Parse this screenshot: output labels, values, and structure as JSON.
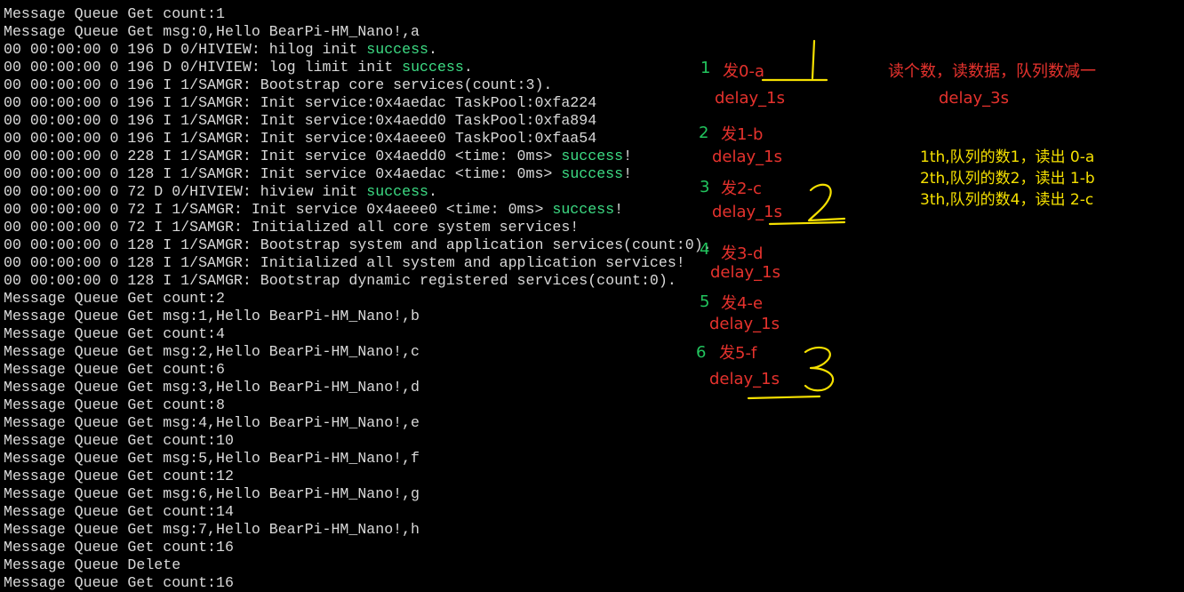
{
  "terminal": {
    "lines": [
      {
        "text": "Message Queue Get count:1"
      },
      {
        "text": "Message Queue Get msg:0,Hello BearPi-HM_Nano!,a"
      },
      {
        "text": "00 00:00:00 0 196 D 0/HIVIEW: hilog init ",
        "hl": "success",
        "tail": "."
      },
      {
        "text": "00 00:00:00 0 196 D 0/HIVIEW: log limit init ",
        "hl": "success",
        "tail": "."
      },
      {
        "text": "00 00:00:00 0 196 I 1/SAMGR: Bootstrap core services(count:3)."
      },
      {
        "text": "00 00:00:00 0 196 I 1/SAMGR: Init service:0x4aedac TaskPool:0xfa224"
      },
      {
        "text": "00 00:00:00 0 196 I 1/SAMGR: Init service:0x4aedd0 TaskPool:0xfa894"
      },
      {
        "text": "00 00:00:00 0 196 I 1/SAMGR: Init service:0x4aeee0 TaskPool:0xfaa54"
      },
      {
        "text": "00 00:00:00 0 228 I 1/SAMGR: Init service 0x4aedd0 <time: 0ms> ",
        "hl": "success",
        "tail": "!"
      },
      {
        "text": "00 00:00:00 0 128 I 1/SAMGR: Init service 0x4aedac <time: 0ms> ",
        "hl": "success",
        "tail": "!"
      },
      {
        "text": "00 00:00:00 0 72 D 0/HIVIEW: hiview init ",
        "hl": "success",
        "tail": "."
      },
      {
        "text": "00 00:00:00 0 72 I 1/SAMGR: Init service 0x4aeee0 <time: 0ms> ",
        "hl": "success",
        "tail": "!"
      },
      {
        "text": "00 00:00:00 0 72 I 1/SAMGR: Initialized all core system services!"
      },
      {
        "text": "00 00:00:00 0 128 I 1/SAMGR: Bootstrap system and application services(count:0)."
      },
      {
        "text": "00 00:00:00 0 128 I 1/SAMGR: Initialized all system and application services!"
      },
      {
        "text": "00 00:00:00 0 128 I 1/SAMGR: Bootstrap dynamic registered services(count:0)."
      },
      {
        "text": "Message Queue Get count:2"
      },
      {
        "text": "Message Queue Get msg:1,Hello BearPi-HM_Nano!,b"
      },
      {
        "text": "Message Queue Get count:4"
      },
      {
        "text": "Message Queue Get msg:2,Hello BearPi-HM_Nano!,c"
      },
      {
        "text": "Message Queue Get count:6"
      },
      {
        "text": "Message Queue Get msg:3,Hello BearPi-HM_Nano!,d"
      },
      {
        "text": "Message Queue Get count:8"
      },
      {
        "text": "Message Queue Get msg:4,Hello BearPi-HM_Nano!,e"
      },
      {
        "text": "Message Queue Get count:10"
      },
      {
        "text": "Message Queue Get msg:5,Hello BearPi-HM_Nano!,f"
      },
      {
        "text": "Message Queue Get count:12"
      },
      {
        "text": "Message Queue Get msg:6,Hello BearPi-HM_Nano!,g"
      },
      {
        "text": "Message Queue Get count:14"
      },
      {
        "text": "Message Queue Get msg:7,Hello BearPi-HM_Nano!,h"
      },
      {
        "text": "Message Queue Get count:16"
      },
      {
        "text": "Message Queue Delete"
      },
      {
        "text": "Message Queue Get count:16"
      }
    ]
  },
  "annotations": {
    "sends": [
      {
        "num": "1",
        "label": "发0-a",
        "delay": "delay_1s"
      },
      {
        "num": "2",
        "label": "发1-b",
        "delay": "delay_1s"
      },
      {
        "num": "3",
        "label": "发2-c",
        "delay": "delay_1s"
      },
      {
        "num": "4",
        "label": "发3-d",
        "delay": "delay_1s"
      },
      {
        "num": "5",
        "label": "发4-e",
        "delay": "delay_1s"
      },
      {
        "num": "6",
        "label": "发5-f",
        "delay": "delay_1s"
      }
    ],
    "reader": {
      "title": "读个数，读数据，队列数减一",
      "delay": "delay_3s"
    },
    "notes": [
      "1th,队列的数1，读出 0-a",
      "2th,队列的数2，读出 1-b",
      "3th,队列的数4，读出 2-c"
    ],
    "handwritten": [
      "1",
      "2",
      "3"
    ]
  },
  "colors": {
    "background": "#000000",
    "text": "#d9d9d9",
    "success": "#3ddc84",
    "annotation_green": "#22c55e",
    "annotation_red": "#e5322d",
    "annotation_yellow": "#f5e000"
  }
}
